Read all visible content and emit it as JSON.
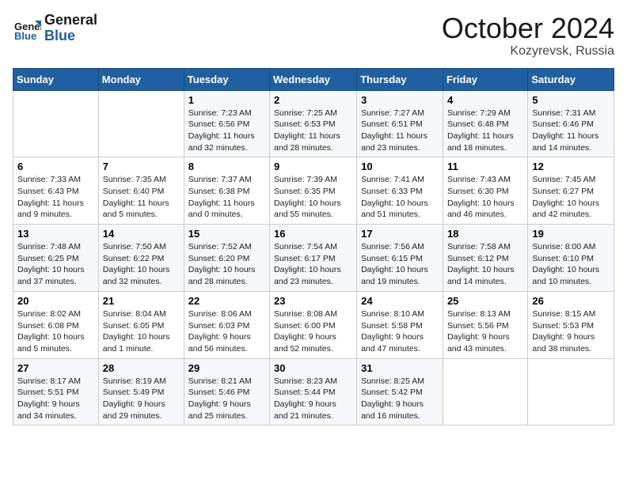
{
  "header": {
    "logo_line1": "General",
    "logo_line2": "Blue",
    "month": "October 2024",
    "location": "Kozyrevsk, Russia"
  },
  "weekdays": [
    "Sunday",
    "Monday",
    "Tuesday",
    "Wednesday",
    "Thursday",
    "Friday",
    "Saturday"
  ],
  "weeks": [
    [
      {
        "day": "",
        "info": ""
      },
      {
        "day": "",
        "info": ""
      },
      {
        "day": "1",
        "info": "Sunrise: 7:23 AM\nSunset: 6:56 PM\nDaylight: 11 hours\nand 32 minutes."
      },
      {
        "day": "2",
        "info": "Sunrise: 7:25 AM\nSunset: 6:53 PM\nDaylight: 11 hours\nand 28 minutes."
      },
      {
        "day": "3",
        "info": "Sunrise: 7:27 AM\nSunset: 6:51 PM\nDaylight: 11 hours\nand 23 minutes."
      },
      {
        "day": "4",
        "info": "Sunrise: 7:29 AM\nSunset: 6:48 PM\nDaylight: 11 hours\nand 18 minutes."
      },
      {
        "day": "5",
        "info": "Sunrise: 7:31 AM\nSunset: 6:46 PM\nDaylight: 11 hours\nand 14 minutes."
      }
    ],
    [
      {
        "day": "6",
        "info": "Sunrise: 7:33 AM\nSunset: 6:43 PM\nDaylight: 11 hours\nand 9 minutes."
      },
      {
        "day": "7",
        "info": "Sunrise: 7:35 AM\nSunset: 6:40 PM\nDaylight: 11 hours\nand 5 minutes."
      },
      {
        "day": "8",
        "info": "Sunrise: 7:37 AM\nSunset: 6:38 PM\nDaylight: 11 hours\nand 0 minutes."
      },
      {
        "day": "9",
        "info": "Sunrise: 7:39 AM\nSunset: 6:35 PM\nDaylight: 10 hours\nand 55 minutes."
      },
      {
        "day": "10",
        "info": "Sunrise: 7:41 AM\nSunset: 6:33 PM\nDaylight: 10 hours\nand 51 minutes."
      },
      {
        "day": "11",
        "info": "Sunrise: 7:43 AM\nSunset: 6:30 PM\nDaylight: 10 hours\nand 46 minutes."
      },
      {
        "day": "12",
        "info": "Sunrise: 7:45 AM\nSunset: 6:27 PM\nDaylight: 10 hours\nand 42 minutes."
      }
    ],
    [
      {
        "day": "13",
        "info": "Sunrise: 7:48 AM\nSunset: 6:25 PM\nDaylight: 10 hours\nand 37 minutes."
      },
      {
        "day": "14",
        "info": "Sunrise: 7:50 AM\nSunset: 6:22 PM\nDaylight: 10 hours\nand 32 minutes."
      },
      {
        "day": "15",
        "info": "Sunrise: 7:52 AM\nSunset: 6:20 PM\nDaylight: 10 hours\nand 28 minutes."
      },
      {
        "day": "16",
        "info": "Sunrise: 7:54 AM\nSunset: 6:17 PM\nDaylight: 10 hours\nand 23 minutes."
      },
      {
        "day": "17",
        "info": "Sunrise: 7:56 AM\nSunset: 6:15 PM\nDaylight: 10 hours\nand 19 minutes."
      },
      {
        "day": "18",
        "info": "Sunrise: 7:58 AM\nSunset: 6:12 PM\nDaylight: 10 hours\nand 14 minutes."
      },
      {
        "day": "19",
        "info": "Sunrise: 8:00 AM\nSunset: 6:10 PM\nDaylight: 10 hours\nand 10 minutes."
      }
    ],
    [
      {
        "day": "20",
        "info": "Sunrise: 8:02 AM\nSunset: 6:08 PM\nDaylight: 10 hours\nand 5 minutes."
      },
      {
        "day": "21",
        "info": "Sunrise: 8:04 AM\nSunset: 6:05 PM\nDaylight: 10 hours\nand 1 minute."
      },
      {
        "day": "22",
        "info": "Sunrise: 8:06 AM\nSunset: 6:03 PM\nDaylight: 9 hours\nand 56 minutes."
      },
      {
        "day": "23",
        "info": "Sunrise: 8:08 AM\nSunset: 6:00 PM\nDaylight: 9 hours\nand 52 minutes."
      },
      {
        "day": "24",
        "info": "Sunrise: 8:10 AM\nSunset: 5:58 PM\nDaylight: 9 hours\nand 47 minutes."
      },
      {
        "day": "25",
        "info": "Sunrise: 8:13 AM\nSunset: 5:56 PM\nDaylight: 9 hours\nand 43 minutes."
      },
      {
        "day": "26",
        "info": "Sunrise: 8:15 AM\nSunset: 5:53 PM\nDaylight: 9 hours\nand 38 minutes."
      }
    ],
    [
      {
        "day": "27",
        "info": "Sunrise: 8:17 AM\nSunset: 5:51 PM\nDaylight: 9 hours\nand 34 minutes."
      },
      {
        "day": "28",
        "info": "Sunrise: 8:19 AM\nSunset: 5:49 PM\nDaylight: 9 hours\nand 29 minutes."
      },
      {
        "day": "29",
        "info": "Sunrise: 8:21 AM\nSunset: 5:46 PM\nDaylight: 9 hours\nand 25 minutes."
      },
      {
        "day": "30",
        "info": "Sunrise: 8:23 AM\nSunset: 5:44 PM\nDaylight: 9 hours\nand 21 minutes."
      },
      {
        "day": "31",
        "info": "Sunrise: 8:25 AM\nSunset: 5:42 PM\nDaylight: 9 hours\nand 16 minutes."
      },
      {
        "day": "",
        "info": ""
      },
      {
        "day": "",
        "info": ""
      }
    ]
  ]
}
